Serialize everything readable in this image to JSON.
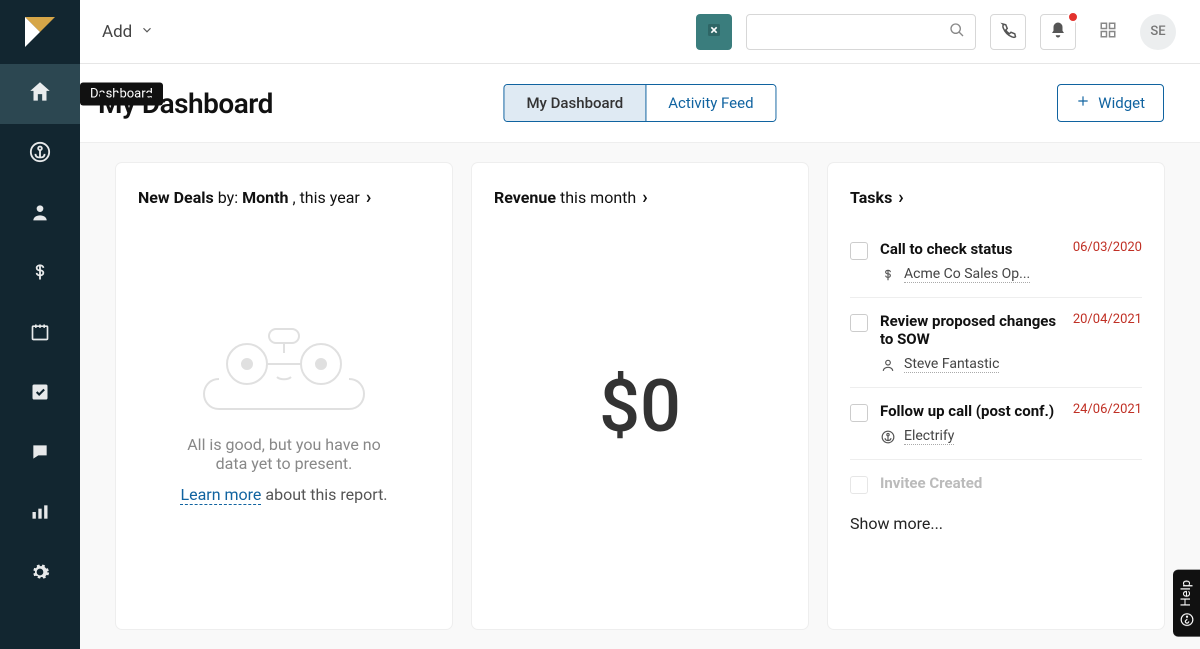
{
  "sidebar": {
    "tooltip": "Dashboard"
  },
  "topbar": {
    "add_label": "Add",
    "avatar_initials": "SE"
  },
  "header": {
    "title": "My Dashboard",
    "tabs": {
      "my_dashboard": "My Dashboard",
      "activity_feed": "Activity Feed"
    },
    "widget_label": "Widget"
  },
  "card_deals": {
    "title_prefix": "New Deals",
    "title_by": " by: ",
    "title_dim": "Month",
    "title_range": ", this year",
    "empty_line": "All is good, but you have no data yet to present.",
    "learn_more": "Learn more",
    "about_report": " about this report."
  },
  "card_revenue": {
    "title_prefix": "Revenue",
    "title_range": " this month",
    "value": "$0"
  },
  "card_tasks": {
    "title": "Tasks",
    "items": [
      {
        "title": "Call to check status",
        "date": "06/03/2020",
        "sub_icon": "dollar",
        "sub": "Acme Co Sales Op..."
      },
      {
        "title": "Review proposed changes to SOW",
        "date": "20/04/2021",
        "sub_icon": "person",
        "sub": "Steve Fantastic"
      },
      {
        "title": "Follow up call (post conf.)",
        "date": "24/06/2021",
        "sub_icon": "anchor",
        "sub": "Electrify"
      },
      {
        "title": "Invitee Created",
        "date": "",
        "sub_icon": "",
        "sub": ""
      }
    ],
    "show_more": "Show more..."
  },
  "help_label": "Help"
}
